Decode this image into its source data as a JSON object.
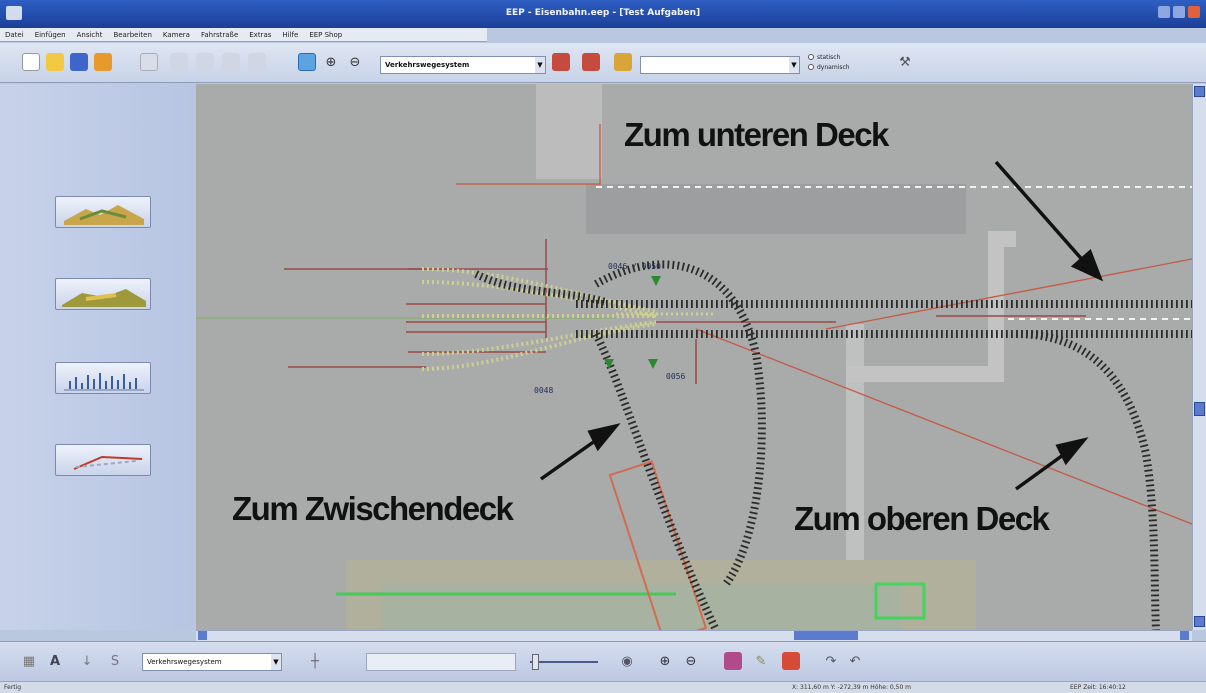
{
  "window": {
    "title": "EEP - Eisenbahn.eep - [Test Aufgaben]"
  },
  "menu": [
    "Datei",
    "Einfügen",
    "Ansicht",
    "Bearbeiten",
    "Kamera",
    "Fahrstraße",
    "Extras",
    "Hilfe",
    "EEP Shop"
  ],
  "toolbar": {
    "track_system_label": "Verkehrswegesystem",
    "object_select_value": "",
    "radio_static": "statisch",
    "radio_dynamic": "dynamisch"
  },
  "sidebar": {
    "buttons": [
      "3d-landscape-view",
      "terrain-view",
      "elevation-profile-view",
      "track-editor-view"
    ]
  },
  "annotations": {
    "lower_deck": "Zum unteren Deck",
    "middle_deck": "Zum Zwischendeck",
    "upper_deck": "Zum oberen Deck"
  },
  "track_labels": [
    "0046 / 0050",
    "0048",
    "0056"
  ],
  "bottom": {
    "track_system_label": "Verkehrswegesystem"
  },
  "status": {
    "left": "Fertig",
    "coords": "X: 311,60 m  Y: -272,39 m  Höhe: 0,50 m",
    "time": "EEP Zeit: 16:40:12"
  },
  "colors": {
    "title_bar": "#1b3f98",
    "ground": "#a9abaa",
    "sidebar": "#b9c7df",
    "track_sleeper": "#2c2c2c",
    "guide_line": "#d36b50"
  }
}
